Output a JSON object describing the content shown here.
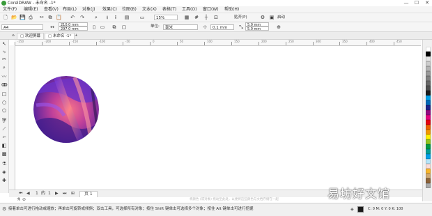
{
  "window": {
    "title": "CorelDRAW - 未命名 -1*",
    "controls": [
      "—",
      "☐",
      "✕"
    ]
  },
  "menu": [
    "文件(F)",
    "编辑(E)",
    "查看(V)",
    "布局(L)",
    "对象(J)",
    "效果(C)",
    "位图(B)",
    "文本(X)",
    "表格(T)",
    "工具(O)",
    "窗口(W)",
    "帮助(H)"
  ],
  "std_toolbar": {
    "zoom": "15%",
    "snap_label": "贴齐(P)",
    "launch_label": "启动"
  },
  "property_bar": {
    "page_size": "A4",
    "width": "210.0 mm",
    "height": "297.0 mm",
    "unit_label": "单位:",
    "unit_value": "毫米",
    "nudge": "0.1 mm",
    "dup_x": "5.0 mm",
    "dup_y": "5.0 mm"
  },
  "tabs": {
    "home_icon": "home-icon",
    "welcome": "欢迎屏幕",
    "document": "未命名 -1*",
    "add": "+"
  },
  "ruler": {
    "ticks": [
      "-250",
      "-200",
      "-150",
      "-100",
      "-50",
      "0",
      "50",
      "100",
      "150",
      "200",
      "250",
      "300",
      "350",
      "400",
      "450"
    ]
  },
  "page_nav": {
    "current": "1",
    "of": "的",
    "total": "1",
    "page_tab": "页 1"
  },
  "hint": "将颜色 (或对象) 拖动至此处，以便将这些颜色与文档存储在一起",
  "status": {
    "text": "接着单击可进行拖动或缩放；再单击可旋转或倾斜；双击工具，可选择所有对象；按住 Shift 键单击可选择多个对象；按住 Alt 键单击可进行挖掘",
    "fill_color": "#1a1a1a",
    "cmyk": "C: 0 M: 0 Y: 0 K: 100",
    "outline": "无"
  },
  "palette_colors": [
    "#ffffff",
    "#000000",
    "#e6e6e6",
    "#cccccc",
    "#b3b3b3",
    "#999999",
    "#808080",
    "#666666",
    "#4d4d4d",
    "#1a1a1a",
    "#00a0e9",
    "#0068b7",
    "#1d2088",
    "#920783",
    "#e4007f",
    "#e60012",
    "#eb6100",
    "#f39800",
    "#fff100",
    "#8fc31f",
    "#009944",
    "#009e96",
    "#00a0e9",
    "#b5e5f9",
    "#fadcd9",
    "#f8b62b",
    "#cfa972",
    "#8c6239",
    "#aaaaaa"
  ],
  "watermark": "易坊好文馆"
}
